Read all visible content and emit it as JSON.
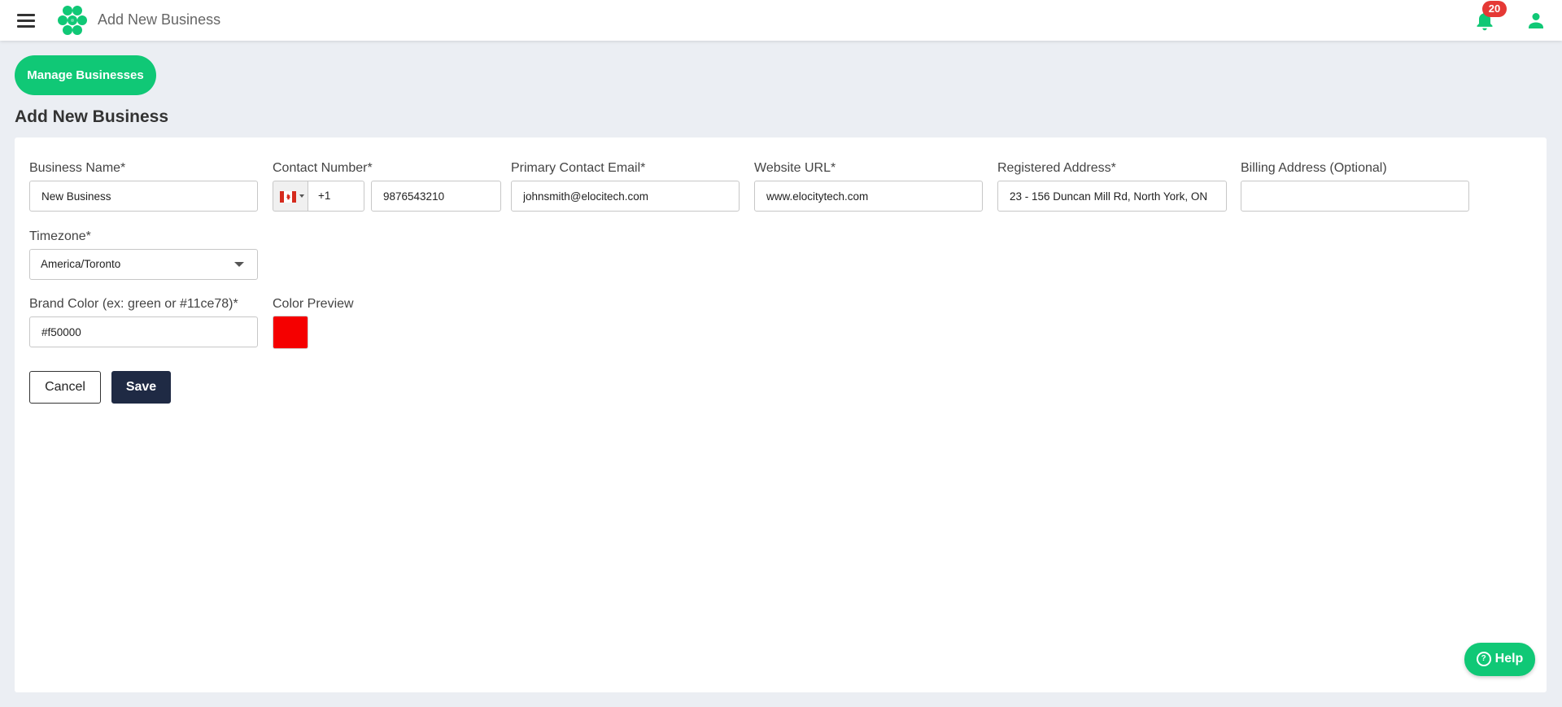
{
  "header": {
    "title": "Add New Business",
    "notification_count": "20",
    "menu_icon": "hamburger-menu-icon",
    "logo_icon": "hexagon-cluster-logo",
    "bell_icon": "bell-icon",
    "user_icon": "user-icon"
  },
  "actions": {
    "manage_businesses_label": "Manage Businesses"
  },
  "page": {
    "heading": "Add New Business"
  },
  "form": {
    "business_name": {
      "label": "Business Name*",
      "value": "New Business"
    },
    "contact_number": {
      "label": "Contact Number*",
      "country_code": "+1",
      "value": "9876543210",
      "flag": "canada-flag-icon"
    },
    "primary_contact_email": {
      "label": "Primary Contact Email*",
      "value": "johnsmith@elocitech.com"
    },
    "website_url": {
      "label": "Website URL*",
      "value": "www.elocitytech.com"
    },
    "registered_address": {
      "label": "Registered Address*",
      "value": "23 - 156 Duncan Mill Rd, North York, ON"
    },
    "billing_address": {
      "label": "Billing Address (Optional)",
      "value": ""
    },
    "timezone": {
      "label": "Timezone*",
      "selected": "America/Toronto"
    },
    "brand_color": {
      "label": "Brand Color (ex: green or #11ce78)*",
      "value": "#f50000"
    },
    "color_preview": {
      "label": "Color Preview",
      "color": "#f50000"
    },
    "cancel_label": "Cancel",
    "save_label": "Save"
  },
  "help": {
    "label": "Help"
  },
  "colors": {
    "accent": "#10c876",
    "primary_dark": "#1f2a44",
    "badge": "#e53935",
    "background": "#ebeef3"
  }
}
